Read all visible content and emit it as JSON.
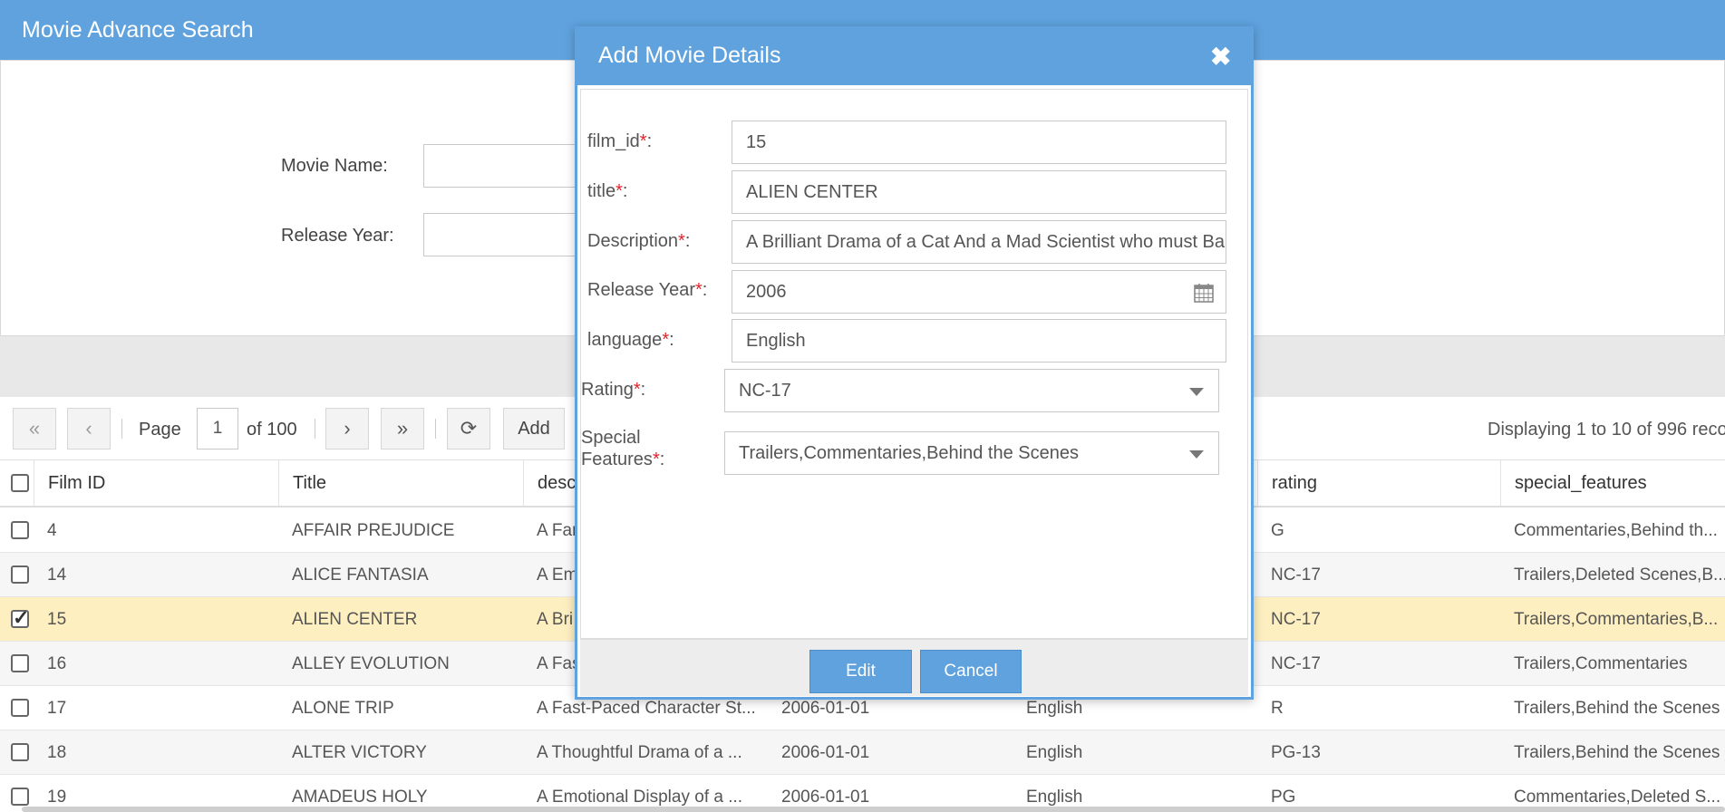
{
  "app": {
    "title": "Movie Advance Search"
  },
  "search": {
    "movie_name_label": "Movie Name:",
    "release_year_label": "Release Year:"
  },
  "toolbar": {
    "page_label": "Page",
    "page_value": "1",
    "of_pages": "of 100",
    "add_label": "Add",
    "displaying": "Displaying 1 to 10 of 996 reco"
  },
  "grid": {
    "columns": [
      "Film ID",
      "Title",
      "desc",
      "",
      "",
      "rating",
      "special_features"
    ],
    "rows": [
      {
        "film_id": "4",
        "title": "AFFAIR PREJUDICE",
        "desc": "A Far",
        "year": "",
        "language": "",
        "rating": "G",
        "special": "Commentaries,Behind th...",
        "checked": false
      },
      {
        "film_id": "14",
        "title": "ALICE FANTASIA",
        "desc": "A Em",
        "year": "",
        "language": "",
        "rating": "NC-17",
        "special": "Trailers,Deleted Scenes,B...",
        "checked": false
      },
      {
        "film_id": "15",
        "title": "ALIEN CENTER",
        "desc": "A Bri",
        "year": "",
        "language": "",
        "rating": "NC-17",
        "special": "Trailers,Commentaries,B...",
        "checked": true
      },
      {
        "film_id": "16",
        "title": "ALLEY EVOLUTION",
        "desc": "A Fas",
        "year": "",
        "language": "",
        "rating": "NC-17",
        "special": "Trailers,Commentaries",
        "checked": false
      },
      {
        "film_id": "17",
        "title": "ALONE TRIP",
        "desc": "A Fast-Paced Character St...",
        "year": "2006-01-01",
        "language": "English",
        "rating": "R",
        "special": "Trailers,Behind the Scenes",
        "checked": false
      },
      {
        "film_id": "18",
        "title": "ALTER VICTORY",
        "desc": "A Thoughtful Drama of a ...",
        "year": "2006-01-01",
        "language": "English",
        "rating": "PG-13",
        "special": "Trailers,Behind the Scenes",
        "checked": false
      },
      {
        "film_id": "19",
        "title": "AMADEUS HOLY",
        "desc": "A Emotional Display of a ...",
        "year": "2006-01-01",
        "language": "English",
        "rating": "PG",
        "special": "Commentaries,Deleted S...",
        "checked": false
      }
    ]
  },
  "dialog": {
    "title": "Add Movie Details",
    "close_glyph": "✖",
    "required_mark": "*",
    "fields": {
      "film_id": {
        "label": "film_id",
        "value": "15"
      },
      "title": {
        "label": "title",
        "value": "ALIEN CENTER"
      },
      "description": {
        "label": "Description",
        "value": "A Brilliant Drama of a Cat And a Mad Scientist who must Ba"
      },
      "release_year": {
        "label": "Release Year",
        "value": "2006"
      },
      "language": {
        "label": "language",
        "value": "English"
      },
      "rating": {
        "label": "Rating",
        "value": "NC-17"
      },
      "special": {
        "label_line1": "Special",
        "label_line2": "Features",
        "value": "Trailers,Commentaries,Behind the Scenes"
      }
    },
    "edit_label": "Edit",
    "cancel_label": "Cancel"
  },
  "colors": {
    "header_blue": "#5fa2dd",
    "required_red": "#e0242a",
    "selected_row": "#fdefc0"
  },
  "icons": [
    "first-page-icon",
    "prev-page-icon",
    "next-page-icon",
    "last-page-icon",
    "refresh-icon",
    "calendar-icon",
    "chevron-down-icon",
    "close-icon"
  ]
}
